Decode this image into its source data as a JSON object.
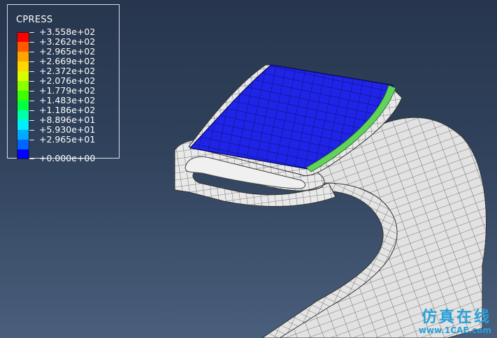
{
  "legend": {
    "title": "CPRESS",
    "entries": [
      {
        "label": "+3.558e+02",
        "color": "#ff0000"
      },
      {
        "label": "+3.262e+02",
        "color": "#ff5a00"
      },
      {
        "label": "+2.965e+02",
        "color": "#ffa500"
      },
      {
        "label": "+2.669e+02",
        "color": "#ffd700"
      },
      {
        "label": "+2.372e+02",
        "color": "#d7ff00"
      },
      {
        "label": "+2.076e+02",
        "color": "#8cff00"
      },
      {
        "label": "+1.779e+02",
        "color": "#3cff00"
      },
      {
        "label": "+1.483e+02",
        "color": "#00ff46"
      },
      {
        "label": "+1.186e+02",
        "color": "#00ffaa"
      },
      {
        "label": "+8.896e+01",
        "color": "#00f0ff"
      },
      {
        "label": "+5.930e+01",
        "color": "#00aaff"
      },
      {
        "label": "+2.965e+01",
        "color": "#0064ff"
      },
      {
        "label": "+0.000e+00",
        "color": "#0000ff"
      }
    ]
  },
  "watermark": {
    "chinese": "仿真在线",
    "url": "www.1CAE.com"
  },
  "colors": {
    "contact_blue": "#1f24e6",
    "mesh_gray": "#e6e6e6",
    "contact_green": "#62d35a"
  }
}
